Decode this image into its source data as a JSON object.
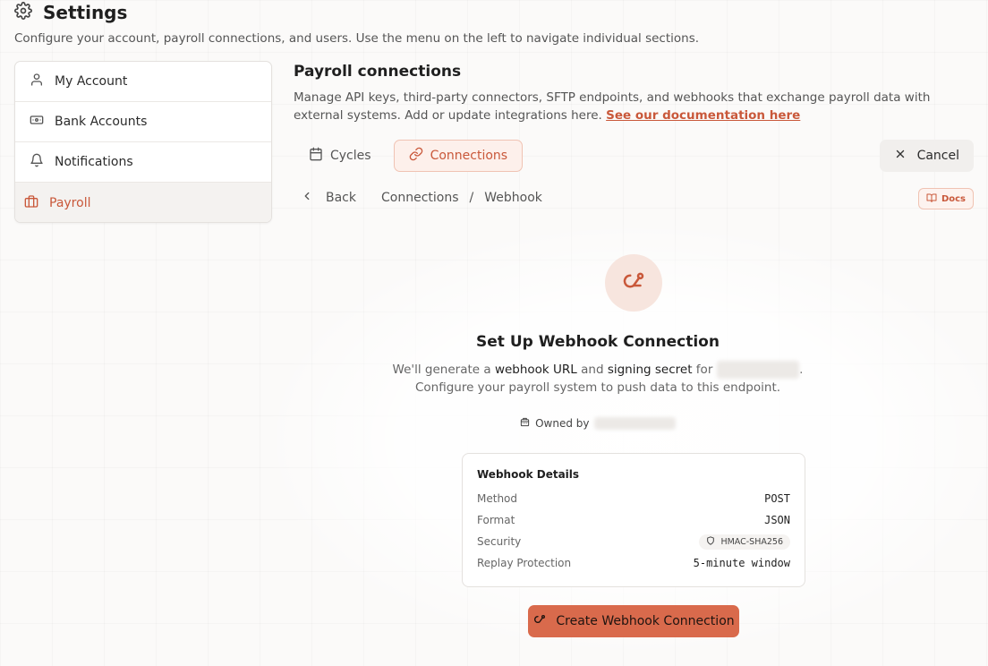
{
  "header": {
    "title": "Settings",
    "subtitle": "Configure your account, payroll connections, and users. Use the menu on the left to navigate individual sections."
  },
  "sidebar": {
    "items": [
      {
        "label": "My Account",
        "icon": "user-icon"
      },
      {
        "label": "Bank Accounts",
        "icon": "banknote-icon"
      },
      {
        "label": "Notifications",
        "icon": "bell-icon"
      },
      {
        "label": "Payroll",
        "icon": "briefcase-icon",
        "active": true
      }
    ]
  },
  "main": {
    "title": "Payroll connections",
    "description": "Manage API keys, third-party connectors, SFTP endpoints, and webhooks that exchange payroll data with external systems. Add or update integrations here.",
    "doc_link": "See our documentation here"
  },
  "tabs": [
    {
      "label": "Cycles",
      "icon": "calendar-icon"
    },
    {
      "label": "Connections",
      "icon": "link-icon",
      "active": true
    }
  ],
  "cancel_label": "Cancel",
  "breadcrumb": {
    "back": "Back",
    "parent": "Connections",
    "separator": "/",
    "current": "Webhook"
  },
  "docs_badge": "Docs",
  "setup": {
    "title": "Set Up Webhook Connection",
    "line1_a": "We'll generate a ",
    "line1_b": "webhook URL",
    "line1_c": " and ",
    "line1_d": "signing secret",
    "line1_e": " for ",
    "line1_f": ".",
    "line2": "Configure your payroll system to push data to this endpoint.",
    "owned_by": "Owned by"
  },
  "details": {
    "title": "Webhook Details",
    "rows": [
      {
        "label": "Method",
        "value": "POST"
      },
      {
        "label": "Format",
        "value": "JSON"
      },
      {
        "label": "Security",
        "value": "HMAC-SHA256"
      },
      {
        "label": "Replay Protection",
        "value": "5-minute window"
      }
    ]
  },
  "create_button": "Create Webhook Connection",
  "colors": {
    "accent": "#c9583a",
    "button": "#d96a4c"
  }
}
